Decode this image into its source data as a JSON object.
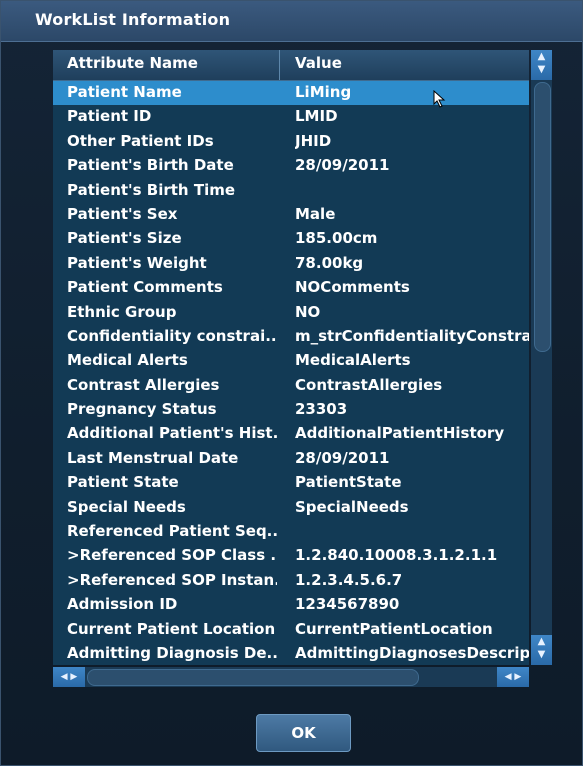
{
  "dialog": {
    "title": "WorkList Information"
  },
  "table": {
    "columns": [
      "Attribute Name",
      "Value"
    ],
    "rows": [
      {
        "attr": "Patient Name",
        "value": "LiMing",
        "selected": true
      },
      {
        "attr": "Patient ID",
        "value": "LMID"
      },
      {
        "attr": "Other Patient IDs",
        "value": "JHID"
      },
      {
        "attr": "Patient's Birth Date",
        "value": "28/09/2011"
      },
      {
        "attr": "Patient's Birth Time",
        "value": ""
      },
      {
        "attr": "Patient's Sex",
        "value": "Male"
      },
      {
        "attr": "Patient's Size",
        "value": "185.00cm"
      },
      {
        "attr": "Patient's Weight",
        "value": "78.00kg"
      },
      {
        "attr": "Patient Comments",
        "value": "NOComments"
      },
      {
        "attr": "Ethnic Group",
        "value": "NO"
      },
      {
        "attr": "Confidentiality constrai...",
        "value": "m_strConfidentialityConstra"
      },
      {
        "attr": "Medical Alerts",
        "value": "MedicalAlerts"
      },
      {
        "attr": "Contrast Allergies",
        "value": "ContrastAllergies"
      },
      {
        "attr": "Pregnancy Status",
        "value": "23303"
      },
      {
        "attr": "Additional Patient's Hist...",
        "value": "AdditionalPatientHistory"
      },
      {
        "attr": "Last Menstrual Date",
        "value": "28/09/2011"
      },
      {
        "attr": "Patient State",
        "value": "PatientState"
      },
      {
        "attr": "Special Needs",
        "value": "SpecialNeeds"
      },
      {
        "attr": "Referenced Patient Seq...",
        "value": ""
      },
      {
        "attr": ">Referenced SOP Class ...",
        "value": "1.2.840.10008.3.1.2.1.1"
      },
      {
        "attr": ">Referenced SOP Instan...",
        "value": "1.2.3.4.5.6.7"
      },
      {
        "attr": "Admission ID",
        "value": "1234567890"
      },
      {
        "attr": "Current Patient Location",
        "value": "CurrentPatientLocation"
      },
      {
        "attr": "Admitting Diagnosis De...",
        "value": "AdmittingDiagnosesDescript"
      }
    ]
  },
  "scrollbar": {
    "up_icon": "arrow-up-icon",
    "down_icon": "arrow-down-icon",
    "left_icon": "arrow-left-icon",
    "right_icon": "arrow-right-icon"
  },
  "buttons": {
    "ok_label": "OK"
  },
  "colors": {
    "title_bar": "#2c4868",
    "table_bg": "#123a55",
    "selected_row": "#2d8dcc",
    "text": "#ffffff"
  }
}
